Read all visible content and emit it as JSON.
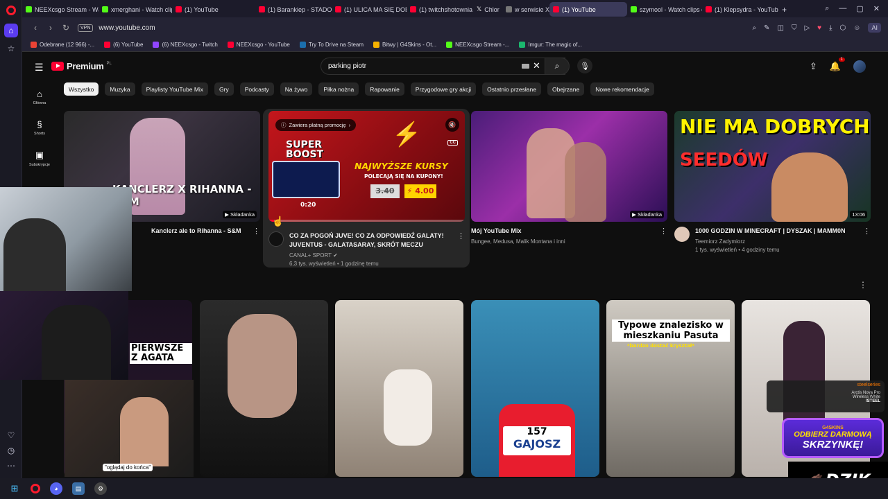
{
  "browser": {
    "tabs": [
      {
        "label": "NEEXcsgo Stream - Watc",
        "icon": "kick"
      },
      {
        "label": "xmerghani - Watch clips",
        "icon": "kick"
      },
      {
        "label": "(1) YouTube",
        "icon": "youtube"
      },
      {
        "label": "(1) Barankiep - STADO -",
        "icon": "youtube"
      },
      {
        "label": "(1) ULICA MA SIĘ DOBRZ",
        "icon": "youtube"
      },
      {
        "label": "(1) twitchshotownia - Yo",
        "icon": "youtube"
      },
      {
        "label": "Chlor",
        "icon": "x"
      },
      {
        "label": "w serwisie X",
        "icon": "x"
      },
      {
        "label": "(1) YouTube",
        "icon": "youtube",
        "active": true
      },
      {
        "label": "szymool - Watch clips o",
        "icon": "kick"
      },
      {
        "label": "(1) Klepsydra - YouTube",
        "icon": "youtube"
      }
    ],
    "url": "www.youtube.com",
    "vpn_label": "VPN",
    "ai_label": "AI",
    "bookmarks": [
      "Odebrane (12 966) -...",
      "(6) YouTube",
      "(6) NEEXcsgo - Twitch",
      "NEEXcsgo - YouTube",
      "Try To Drive na Steam",
      "Bitwy | G4Skins - Ot...",
      "NEEXcsgo Stream -...",
      "Imgur: The magic of..."
    ]
  },
  "youtube": {
    "brand": "Premium",
    "region": "PL",
    "search_value": "parking piotr",
    "notification_count": "1",
    "nav": [
      {
        "label": "Główna",
        "icon": "home-icon"
      },
      {
        "label": "Shorts",
        "icon": "shorts-icon"
      },
      {
        "label": "Subskrypcje",
        "icon": "subscriptions-icon"
      }
    ],
    "chips": [
      "Wszystko",
      "Muzyka",
      "Playlisty YouTube Mix",
      "Gry",
      "Podcasty",
      "Na żywo",
      "Piłka nożna",
      "Rapowanie",
      "Przygodowe gry akcji",
      "Ostatnio przesłane",
      "Obejrzane",
      "Nowe rekomendacje"
    ],
    "videos": [
      {
        "title": "Kanclerz ale to Rihanna - S&M",
        "thumb_text": "KANCLERZ X RIHANNA - S&M",
        "badge": "Składanka",
        "channel": "",
        "stats": ""
      },
      {
        "title": "CO ZA POGOŃ JUVE! CO ZA ODPOWIEDŹ GALATY! JUVENTUS - GALATASARAY, SKRÓT MECZU",
        "channel": "CANAL+ SPORT",
        "stats": "6,3 tys. wyświetleń • 1 godzinę temu",
        "promo_label": "Zawiera płatną promocję",
        "time": "0:20",
        "ad_line1": "SUPER",
        "ad_line2": "BOOST",
        "ad_title": "NAJWYŻSZE KURSY",
        "ad_sub": "POLECAJĄ SIĘ NA KUPONY!",
        "odds_old": "3.40",
        "odds_new": "4.00",
        "progress": 0.03
      },
      {
        "title": "Mój YouTube Mix",
        "channel": "Bungee, Medusa, Malik Montana i inni",
        "stats": "",
        "badge": "Składanka"
      },
      {
        "title": "1000 GODZIN W MINECRAFT | DYSZAK | MAMM0N",
        "channel": "Teemiorz Zadymiorz",
        "stats": "1 tys. wyświetleń • 4 godziny temu",
        "thumb_l1": "NIE MA DOBRYCH",
        "thumb_l2": "SEEDÓW",
        "duration": "13:06"
      }
    ],
    "shorts": [
      {
        "overlay": "PIERWSZE Z AGATA"
      },
      {
        "overlay": ""
      },
      {
        "overlay": ""
      },
      {
        "overlay": "GAJOSZ",
        "bib": "157"
      },
      {
        "overlay_l1": "Typowe znalezisko w",
        "overlay_l2": "mieszkaniu Pasuta",
        "overlay_l3": "*bardzo dostać kryształ*"
      },
      {
        "overlay": ""
      }
    ]
  },
  "stream": {
    "cam_caption": "\"oglądaj do końca\"",
    "sponsor_small": "G4SKINS",
    "sponsor_l1": "ODBIERZ DARMOWĄ",
    "sponsor_l2": "SKRZYNKĘ!",
    "dzik": "DZIK",
    "steel_brand": "steelseries",
    "steel_l1": "Arctis Nova Pro",
    "steel_l2": "Wireless White",
    "steel_tag": "!STEEL"
  },
  "colors": {
    "youtube_red": "#ff0033",
    "kick_green": "#53fc18",
    "opera_red": "#ff1b2d",
    "accent_purple": "#5b3cf0"
  }
}
